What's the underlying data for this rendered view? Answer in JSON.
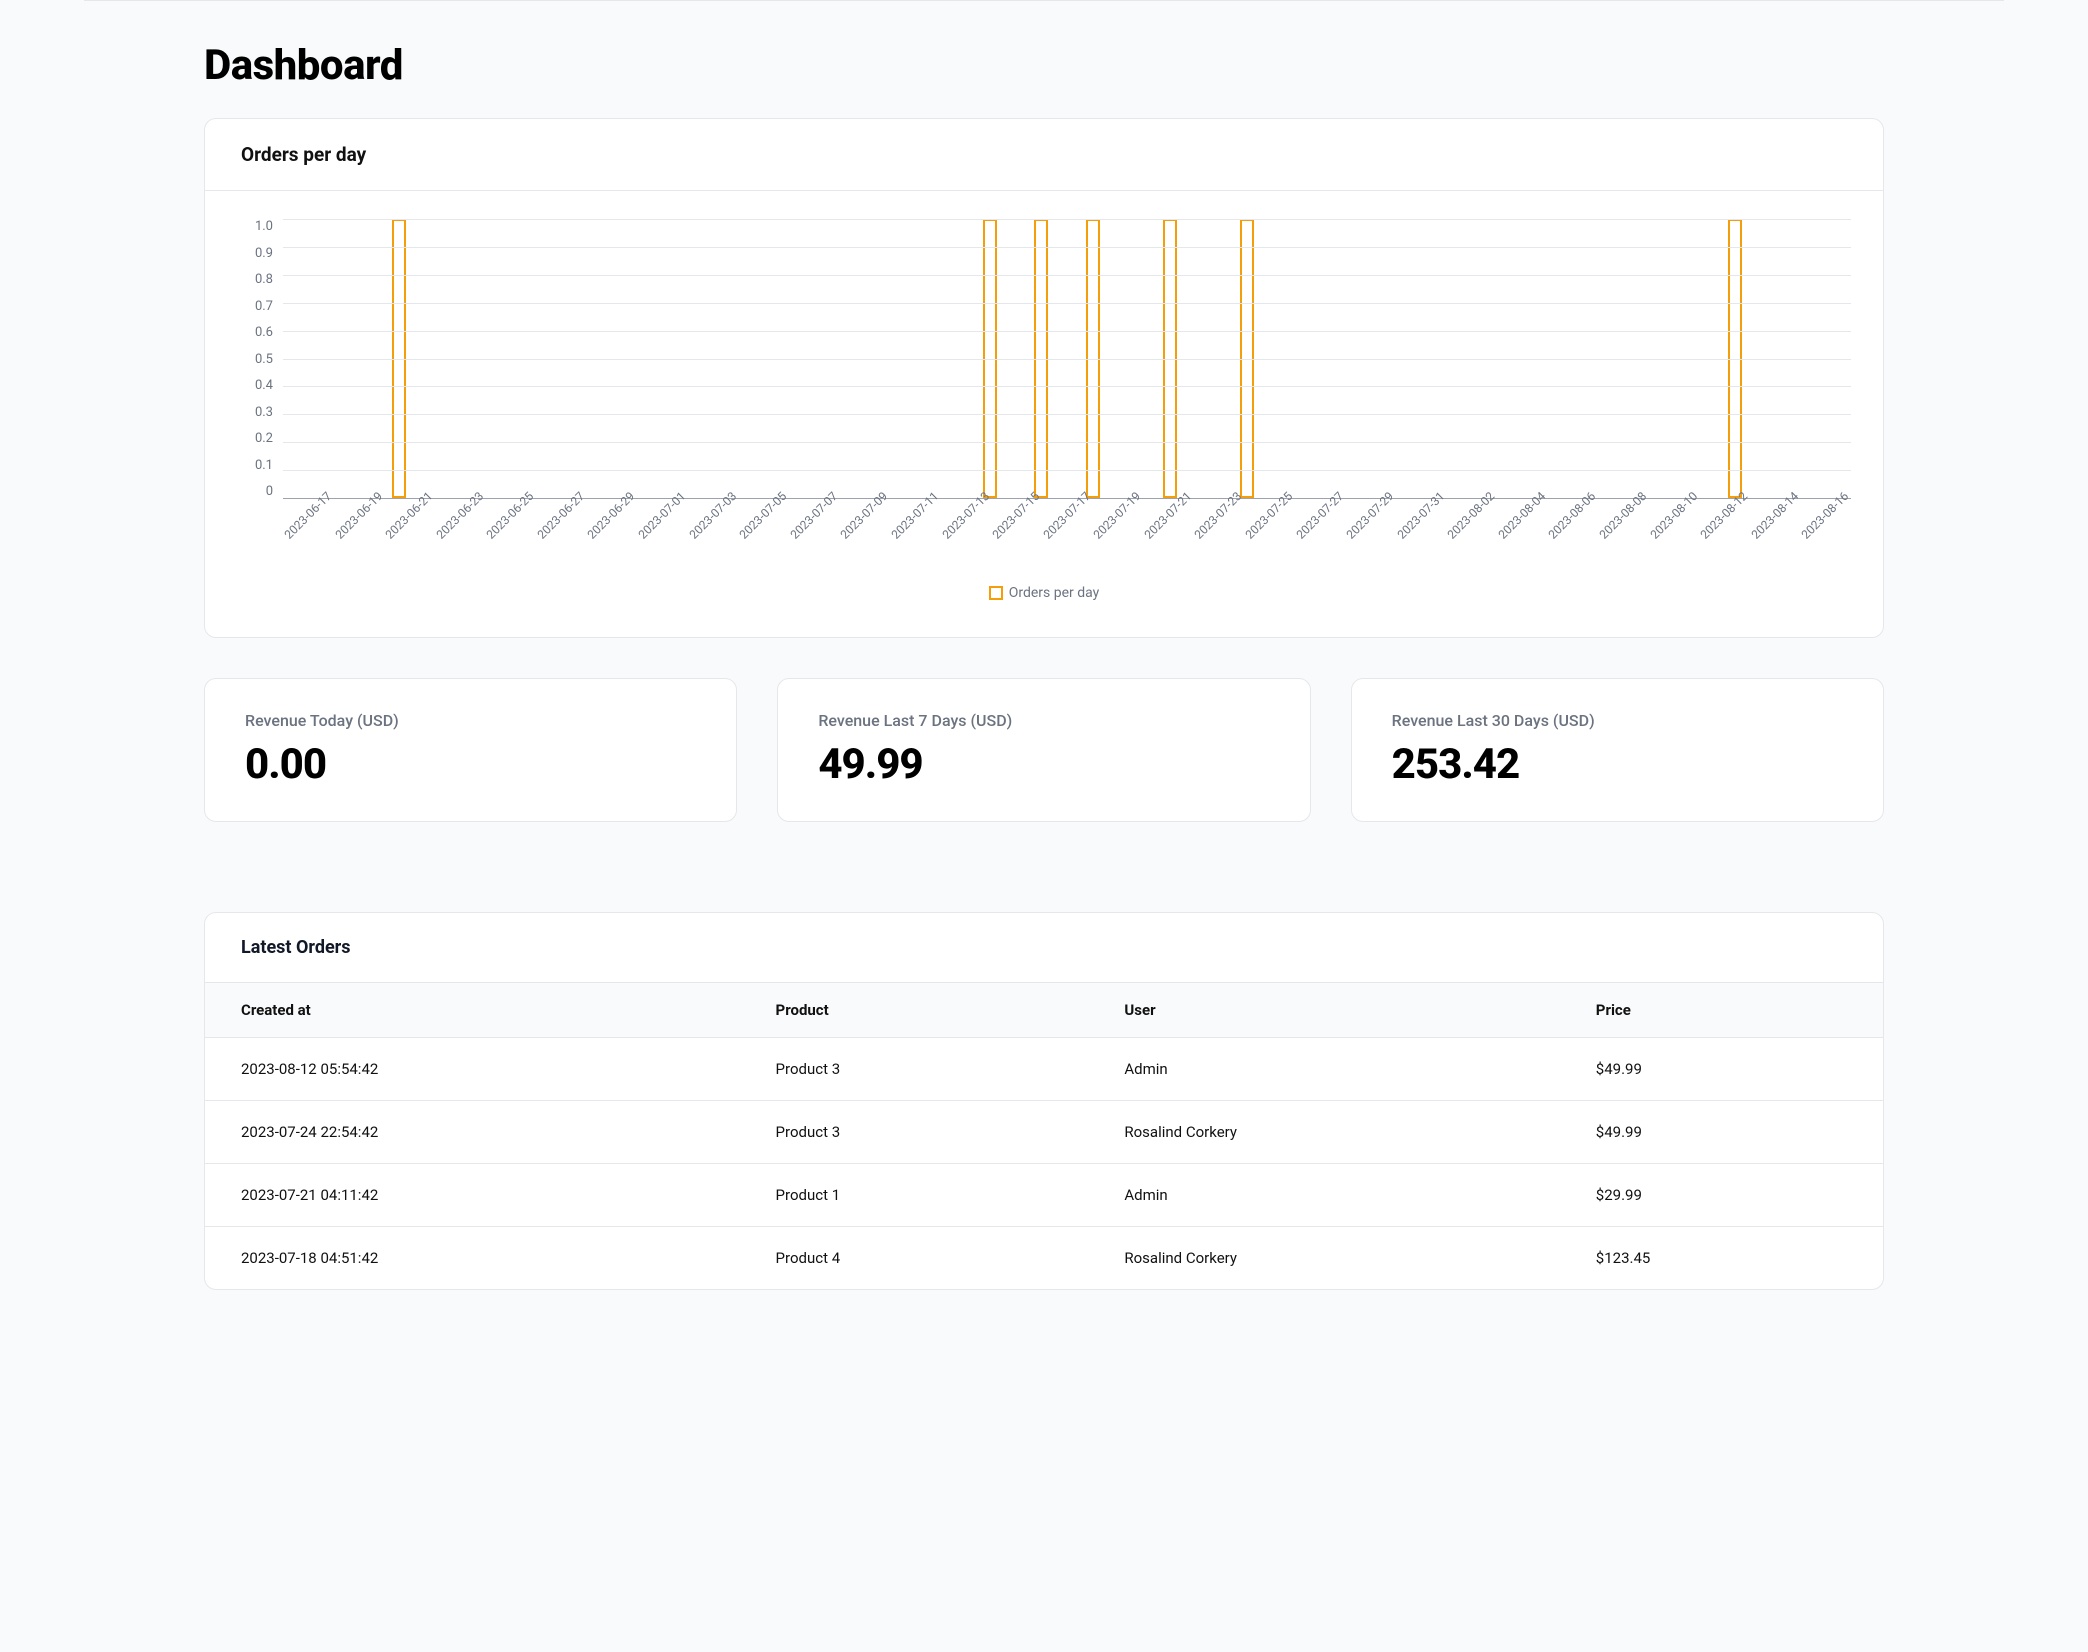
{
  "page": {
    "title": "Dashboard"
  },
  "chart": {
    "title": "Orders per day",
    "legend_label": "Orders per day",
    "y_ticks": [
      "1.0",
      "0.9",
      "0.8",
      "0.7",
      "0.6",
      "0.5",
      "0.4",
      "0.3",
      "0.2",
      "0.1",
      "0"
    ],
    "x_ticks": [
      "2023-06-17",
      "2023-06-19",
      "2023-06-21",
      "2023-06-23",
      "2023-06-25",
      "2023-06-27",
      "2023-06-29",
      "2023-07-01",
      "2023-07-03",
      "2023-07-05",
      "2023-07-07",
      "2023-07-09",
      "2023-07-11",
      "2023-07-13",
      "2023-07-15",
      "2023-07-17",
      "2023-07-19",
      "2023-07-21",
      "2023-07-23",
      "2023-07-25",
      "2023-07-27",
      "2023-07-29",
      "2023-07-31",
      "2023-08-02",
      "2023-08-04",
      "2023-08-06",
      "2023-08-08",
      "2023-08-10",
      "2023-08-12",
      "2023-08-14",
      "2023-08-16"
    ]
  },
  "chart_data": {
    "type": "bar",
    "title": "Orders per day",
    "xlabel": "",
    "ylabel": "",
    "ylim": [
      0,
      1.0
    ],
    "categories": [
      "2023-06-17",
      "2023-06-18",
      "2023-06-19",
      "2023-06-20",
      "2023-06-21",
      "2023-06-22",
      "2023-06-23",
      "2023-06-24",
      "2023-06-25",
      "2023-06-26",
      "2023-06-27",
      "2023-06-28",
      "2023-06-29",
      "2023-06-30",
      "2023-07-01",
      "2023-07-02",
      "2023-07-03",
      "2023-07-04",
      "2023-07-05",
      "2023-07-06",
      "2023-07-07",
      "2023-07-08",
      "2023-07-09",
      "2023-07-10",
      "2023-07-11",
      "2023-07-12",
      "2023-07-13",
      "2023-07-14",
      "2023-07-15",
      "2023-07-16",
      "2023-07-17",
      "2023-07-18",
      "2023-07-19",
      "2023-07-20",
      "2023-07-21",
      "2023-07-22",
      "2023-07-23",
      "2023-07-24",
      "2023-07-25",
      "2023-07-26",
      "2023-07-27",
      "2023-07-28",
      "2023-07-29",
      "2023-07-30",
      "2023-07-31",
      "2023-08-01",
      "2023-08-02",
      "2023-08-03",
      "2023-08-04",
      "2023-08-05",
      "2023-08-06",
      "2023-08-07",
      "2023-08-08",
      "2023-08-09",
      "2023-08-10",
      "2023-08-11",
      "2023-08-12",
      "2023-08-13",
      "2023-08-14",
      "2023-08-15",
      "2023-08-16"
    ],
    "values": [
      0,
      0,
      0,
      0,
      1,
      0,
      0,
      0,
      0,
      0,
      0,
      0,
      0,
      0,
      0,
      0,
      0,
      0,
      0,
      0,
      0,
      0,
      0,
      0,
      0,
      0,
      0,
      1,
      0,
      1,
      0,
      1,
      0,
      0,
      1,
      0,
      0,
      1,
      0,
      0,
      0,
      0,
      0,
      0,
      0,
      0,
      0,
      0,
      0,
      0,
      0,
      0,
      0,
      0,
      0,
      0,
      1,
      0,
      0,
      0,
      0
    ],
    "legend": [
      "Orders per day"
    ]
  },
  "stats": [
    {
      "label": "Revenue Today (USD)",
      "value": "0.00"
    },
    {
      "label": "Revenue Last 7 Days (USD)",
      "value": "49.99"
    },
    {
      "label": "Revenue Last 30 Days (USD)",
      "value": "253.42"
    }
  ],
  "orders_table": {
    "title": "Latest Orders",
    "columns": [
      "Created at",
      "Product",
      "User",
      "Price"
    ],
    "rows": [
      {
        "created_at": "2023-08-12 05:54:42",
        "product": "Product 3",
        "user": "Admin",
        "price": "$49.99"
      },
      {
        "created_at": "2023-07-24 22:54:42",
        "product": "Product 3",
        "user": "Rosalind Corkery",
        "price": "$49.99"
      },
      {
        "created_at": "2023-07-21 04:11:42",
        "product": "Product 1",
        "user": "Admin",
        "price": "$29.99"
      },
      {
        "created_at": "2023-07-18 04:51:42",
        "product": "Product 4",
        "user": "Rosalind Corkery",
        "price": "$123.45"
      }
    ]
  }
}
